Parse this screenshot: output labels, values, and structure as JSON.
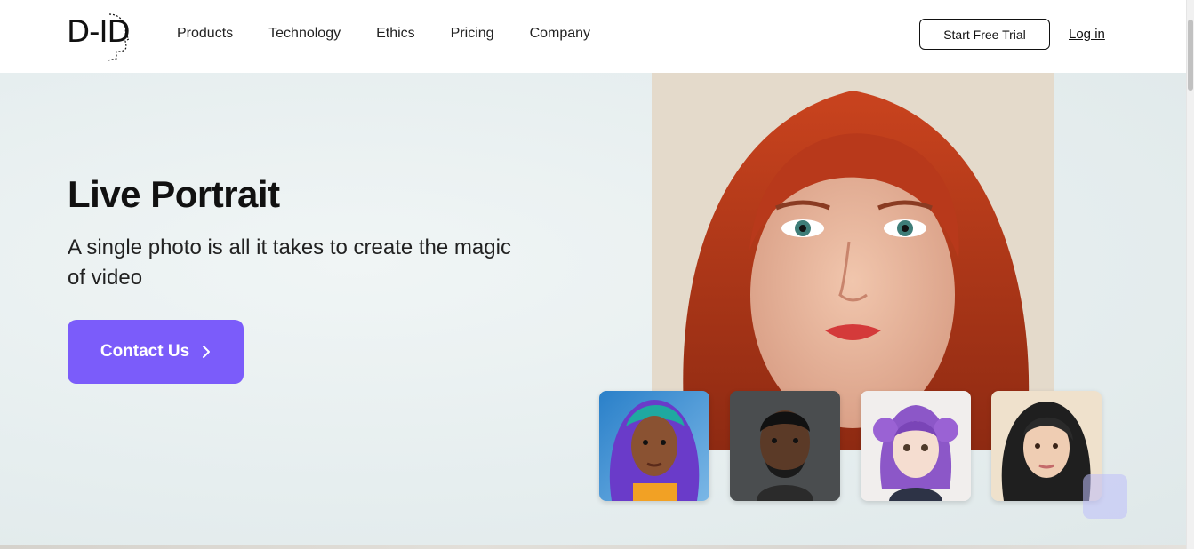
{
  "header": {
    "logo_text": "D-ID",
    "nav": [
      "Products",
      "Technology",
      "Ethics",
      "Pricing",
      "Company"
    ],
    "trial_label": "Start Free Trial",
    "login_label": "Log in"
  },
  "hero": {
    "title": "Live Portrait",
    "subtitle": "A single photo is all it takes to create the magic of video",
    "cta_label": "Contact Us"
  },
  "colors": {
    "accent": "#7b5cfa",
    "background": "#eef3f3"
  }
}
